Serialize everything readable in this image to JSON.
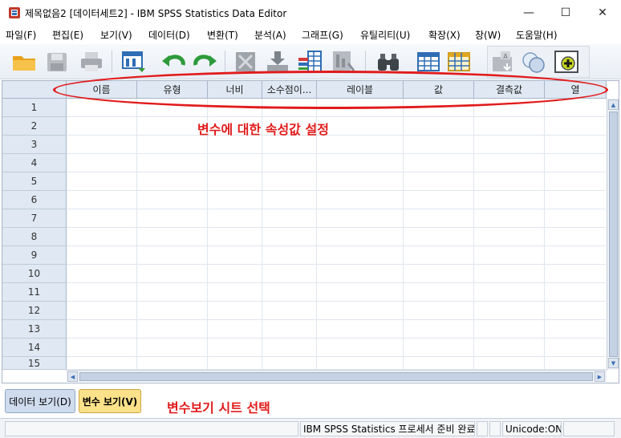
{
  "window": {
    "title": "제목없음2 [데이터세트2] - IBM SPSS Statistics Data Editor",
    "minimize": "—",
    "maximize": "☐",
    "close": "✕"
  },
  "menu": {
    "items": [
      "파일(F)",
      "편집(E)",
      "보기(V)",
      "데이터(D)",
      "변환(T)",
      "분석(A)",
      "그래프(G)",
      "유틸리티(U)",
      "확장(X)",
      "창(W)",
      "도움말(H)"
    ]
  },
  "toolbar": {
    "icons": [
      "open-folder-icon",
      "save-icon",
      "print-icon",
      "recall-dialog-icon",
      "undo-icon",
      "redo-icon",
      "goto-case-icon",
      "goto-variable-icon",
      "variables-icon",
      "run-descriptives-icon",
      "find-icon",
      "insert-cases-icon",
      "insert-variable-icon",
      "split-file-icon",
      "weight-cases-icon",
      "value-labels-icon",
      "use-variable-sets-icon"
    ]
  },
  "grid": {
    "columns": [
      "이름",
      "유형",
      "너비",
      "소수점이...",
      "레이블",
      "값",
      "결측값",
      "열"
    ],
    "rows": [
      "1",
      "2",
      "3",
      "4",
      "5",
      "6",
      "7",
      "8",
      "9",
      "10",
      "11",
      "12",
      "13",
      "14",
      "15"
    ]
  },
  "annotations": {
    "header_note": "변수에 대한 속성값 설정",
    "tab_note": "변수보기 시트 선택",
    "color": "#e11b1b"
  },
  "tabs": {
    "data_view": "데이터 보기(D)",
    "variable_view": "변수 보기(V)"
  },
  "status": {
    "processor": "IBM SPSS Statistics 프로세서 준비 완료",
    "unicode": "Unicode:ON"
  }
}
